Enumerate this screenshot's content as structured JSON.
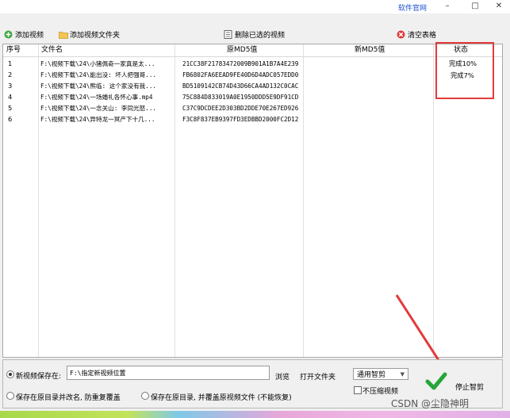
{
  "titlebar": {
    "site_link": "软件官网",
    "minimize": "–",
    "maximize": "□",
    "close": "✕"
  },
  "toolbar": {
    "add_video": "添加视频",
    "add_folder": "添加视频文件夹",
    "delete_selected": "删除已选的视频",
    "clear_table": "清空表格"
  },
  "table": {
    "headers": {
      "index": "序号",
      "filename": "文件名",
      "orig_md5": "原MD5值",
      "new_md5": "新MD5值",
      "status": "状态"
    },
    "rows": [
      {
        "index": "1",
        "filename": "F:\\视频下载\\24\\小猪佩奇一家真是太...",
        "orig_md5": "21CC38F21783472009B901A1B7A4E239",
        "new_md5": "",
        "status": "完成10%"
      },
      {
        "index": "2",
        "filename": "F:\\视频下载\\24\\能出没: 坏人把强哥...",
        "orig_md5": "FB6802FA6EEAD9FE40D6D4ADC057EDD0",
        "new_md5": "",
        "status": "完成7%"
      },
      {
        "index": "3",
        "filename": "F:\\视频下载\\24\\熊临: 这个家没有我...",
        "orig_md5": "BD5109142CB74D43D66CA4AD132C0CAC",
        "new_md5": "",
        "status": ""
      },
      {
        "index": "4",
        "filename": "F:\\视频下载\\24\\一场婚礼各怀心事.mp4",
        "orig_md5": "75C884D833019A0E1950DDD5E9DF91CD",
        "new_md5": "",
        "status": ""
      },
      {
        "index": "5",
        "filename": "F:\\视频下载\\24\\一念关山: 李同光怒...",
        "orig_md5": "C37C9DCDEE2D303BD2DDE70E267ED926",
        "new_md5": "",
        "status": ""
      },
      {
        "index": "6",
        "filename": "F:\\视频下载\\24\\异特龙一冥产下十几...",
        "orig_md5": "F3C8F837EB9397FD3EDBBD2000FC2D12",
        "new_md5": "",
        "status": ""
      }
    ]
  },
  "bottom": {
    "save_new_label": "新视频保存在:",
    "save_path_value": "F:\\指定新视频位置",
    "browse": "浏览",
    "open_folder": "打开文件夹",
    "save_original_rename": "保存在原目录并改名, 防重复覆盖",
    "save_original_overwrite": "保存在原目录, 并覆盖原视频文件 (不能恢复)",
    "speed_select": "通用智剪",
    "no_compress": "不压缩视频",
    "stop_button": "停止智剪"
  },
  "watermark": "CSDN @尘隐神明",
  "colors": {
    "accent_red": "#e23b3b",
    "link_blue": "#1a4fd0",
    "check_green": "#27a53a"
  }
}
